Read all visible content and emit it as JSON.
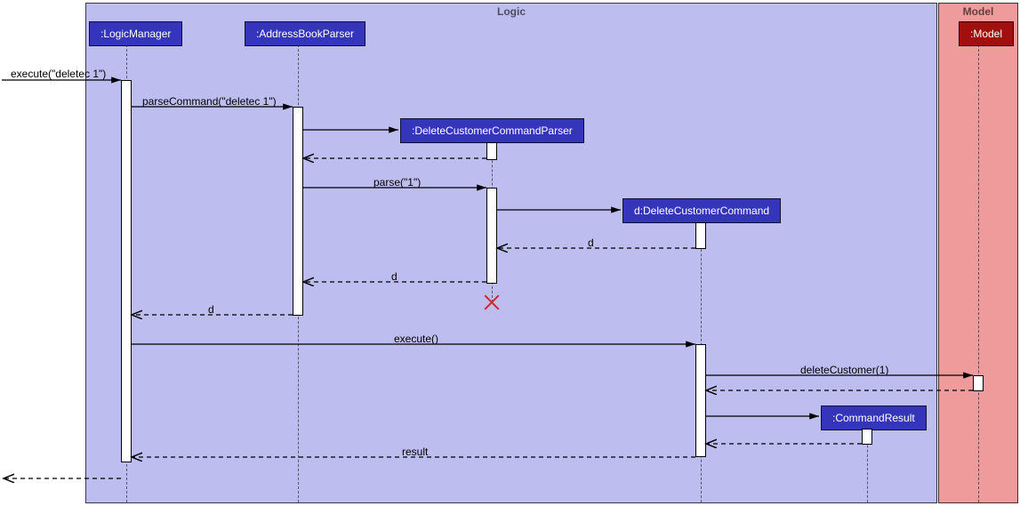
{
  "frames": {
    "logic": {
      "label": "Logic"
    },
    "model": {
      "label": "Model"
    }
  },
  "participants": {
    "logicManager": ":LogicManager",
    "addressBookParser": ":AddressBookParser",
    "deleteCustomerCommandParser": ":DeleteCustomerCommandParser",
    "deleteCustomerCommand": "d:DeleteCustomerCommand",
    "commandResult": ":CommandResult",
    "model": ":Model"
  },
  "messages": {
    "externalCall": "execute(\"deletec 1\")",
    "parseCommand": "parseCommand(\"deletec 1\")",
    "parse": "parse(\"1\")",
    "returnD_parserToABP": "d",
    "returnD_dccpToABP": "d",
    "returnD_ABPToLM": "d",
    "execute": "execute()",
    "deleteCustomer": "deleteCustomer(1)",
    "result": "result"
  },
  "chart_data": {
    "type": "sequence_diagram",
    "frames": [
      {
        "name": "Logic",
        "participants": [
          "LogicManager",
          "AddressBookParser",
          "DeleteCustomerCommandParser",
          "DeleteCustomerCommand",
          "CommandResult"
        ]
      },
      {
        "name": "Model",
        "participants": [
          "Model"
        ]
      }
    ],
    "participants": [
      {
        "id": "external",
        "name": "(external actor)"
      },
      {
        "id": "LogicManager",
        "name": ":LogicManager",
        "frame": "Logic"
      },
      {
        "id": "AddressBookParser",
        "name": ":AddressBookParser",
        "frame": "Logic"
      },
      {
        "id": "DeleteCustomerCommandParser",
        "name": ":DeleteCustomerCommandParser",
        "frame": "Logic",
        "created_by_message": 3
      },
      {
        "id": "DeleteCustomerCommand",
        "name": "d:DeleteCustomerCommand",
        "frame": "Logic",
        "created_by_message": 6
      },
      {
        "id": "CommandResult",
        "name": ":CommandResult",
        "frame": "Logic",
        "created_by_message": 13
      },
      {
        "id": "Model",
        "name": ":Model",
        "frame": "Model"
      }
    ],
    "messages": [
      {
        "n": 1,
        "from": "external",
        "to": "LogicManager",
        "label": "execute(\"deletec 1\")",
        "kind": "sync"
      },
      {
        "n": 2,
        "from": "LogicManager",
        "to": "AddressBookParser",
        "label": "parseCommand(\"deletec 1\")",
        "kind": "sync"
      },
      {
        "n": 3,
        "from": "AddressBookParser",
        "to": "DeleteCustomerCommandParser",
        "label": "",
        "kind": "create"
      },
      {
        "n": 4,
        "from": "DeleteCustomerCommandParser",
        "to": "AddressBookParser",
        "label": "",
        "kind": "return"
      },
      {
        "n": 5,
        "from": "AddressBookParser",
        "to": "DeleteCustomerCommandParser",
        "label": "parse(\"1\")",
        "kind": "sync"
      },
      {
        "n": 6,
        "from": "DeleteCustomerCommandParser",
        "to": "DeleteCustomerCommand",
        "label": "",
        "kind": "create"
      },
      {
        "n": 7,
        "from": "DeleteCustomerCommand",
        "to": "DeleteCustomerCommandParser",
        "label": "d",
        "kind": "return"
      },
      {
        "n": 8,
        "from": "DeleteCustomerCommandParser",
        "to": "AddressBookParser",
        "label": "d",
        "kind": "return"
      },
      {
        "n": 9,
        "event": "destroy",
        "target": "DeleteCustomerCommandParser"
      },
      {
        "n": 10,
        "from": "AddressBookParser",
        "to": "LogicManager",
        "label": "d",
        "kind": "return"
      },
      {
        "n": 11,
        "from": "LogicManager",
        "to": "DeleteCustomerCommand",
        "label": "execute()",
        "kind": "sync"
      },
      {
        "n": 12,
        "from": "DeleteCustomerCommand",
        "to": "Model",
        "label": "deleteCustomer(1)",
        "kind": "sync"
      },
      {
        "n": 13,
        "from": "Model",
        "to": "DeleteCustomerCommand",
        "label": "",
        "kind": "return"
      },
      {
        "n": 14,
        "from": "DeleteCustomerCommand",
        "to": "CommandResult",
        "label": "",
        "kind": "create"
      },
      {
        "n": 15,
        "from": "CommandResult",
        "to": "DeleteCustomerCommand",
        "label": "",
        "kind": "return"
      },
      {
        "n": 16,
        "from": "DeleteCustomerCommand",
        "to": "LogicManager",
        "label": "result",
        "kind": "return"
      },
      {
        "n": 17,
        "from": "LogicManager",
        "to": "external",
        "label": "",
        "kind": "return"
      }
    ]
  }
}
